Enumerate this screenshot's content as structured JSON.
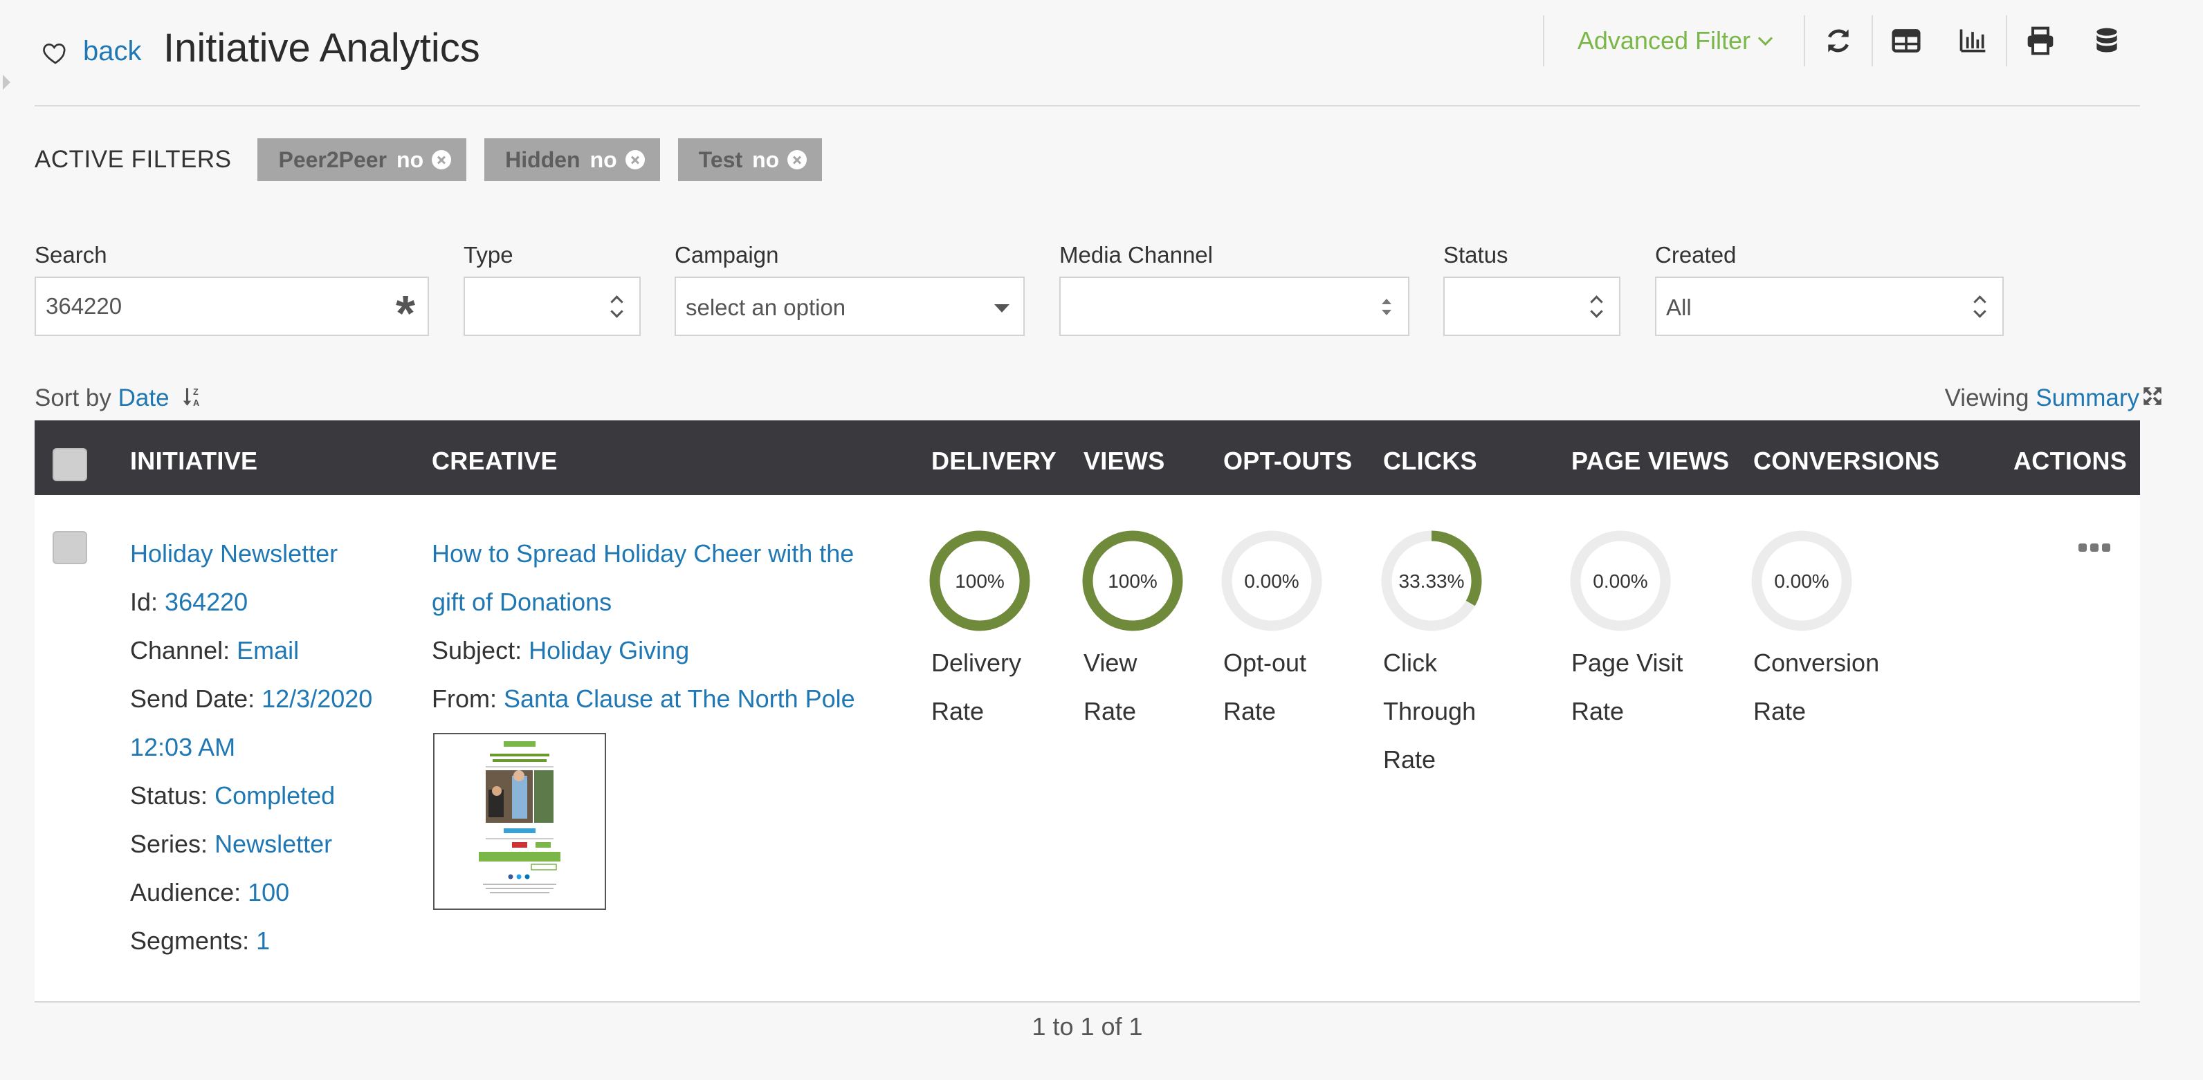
{
  "header": {
    "back_label": "back",
    "title": "Initiative Analytics",
    "advanced_filter_label": "Advanced Filter",
    "toolbar_icons": [
      "refresh-icon",
      "table-icon",
      "bar-chart-icon",
      "print-icon",
      "database-icon"
    ]
  },
  "active_filters": {
    "label": "ACTIVE FILTERS",
    "chips": [
      {
        "key": "Peer2Peer",
        "value": "no"
      },
      {
        "key": "Hidden",
        "value": "no"
      },
      {
        "key": "Test",
        "value": "no"
      }
    ]
  },
  "search": {
    "search_label": "Search",
    "search_value": "364220",
    "type_label": "Type",
    "type_value": "",
    "campaign_label": "Campaign",
    "campaign_placeholder": "select an option",
    "media_label": "Media Channel",
    "media_value": "",
    "status_label": "Status",
    "status_value": "",
    "created_label": "Created",
    "created_value": "All"
  },
  "sort": {
    "prefix": "Sort by",
    "field": "Date",
    "viewing_prefix": "Viewing",
    "viewing_mode": "Summary"
  },
  "table": {
    "columns": [
      "INITIATIVE",
      "CREATIVE",
      "DELIVERY",
      "VIEWS",
      "OPT-OUTS",
      "CLICKS",
      "PAGE VIEWS",
      "CONVERSIONS",
      "ACTIONS"
    ],
    "row": {
      "initiative": {
        "name": "Holiday Newsletter",
        "id_label": "Id:",
        "id_value": "364220",
        "channel_label": "Channel:",
        "channel_value": "Email",
        "send_label": "Send Date:",
        "send_date": "12/3/2020",
        "send_time": "12:03 AM",
        "status_label": "Status:",
        "status_value": "Completed",
        "series_label": "Series:",
        "series_value": "Newsletter",
        "audience_label": "Audience:",
        "audience_value": "100",
        "segments_label": "Segments:",
        "segments_value": "1"
      },
      "creative": {
        "title_line1": "How to Spread Holiday Cheer with the",
        "title_line2": "gift of Donations",
        "subject_label": "Subject:",
        "subject_value": "Holiday Giving",
        "from_label": "From:",
        "from_value": "Santa Clause at The North Pole"
      },
      "metrics": [
        {
          "text": "100%",
          "fraction": 1.0,
          "label_lines": [
            "Delivery",
            "Rate"
          ]
        },
        {
          "text": "100%",
          "fraction": 1.0,
          "label_lines": [
            "View",
            "Rate"
          ]
        },
        {
          "text": "0.00%",
          "fraction": 0.0,
          "label_lines": [
            "Opt-out",
            "Rate"
          ]
        },
        {
          "text": "33.33%",
          "fraction": 0.3333,
          "label_lines": [
            "Click",
            "Through",
            "Rate"
          ]
        },
        {
          "text": "0.00%",
          "fraction": 0.0,
          "label_lines": [
            "Page Visit",
            "Rate"
          ]
        },
        {
          "text": "0.00%",
          "fraction": 0.0,
          "label_lines": [
            "Conversion",
            "Rate"
          ]
        }
      ]
    }
  },
  "pager": {
    "text": "1 to 1 of 1"
  },
  "colors": {
    "ring_fill": "#6f8a3a",
    "ring_track": "#ececec",
    "link": "#1f78b4",
    "accent_green": "#7ab648",
    "header_bg": "#3a3a3e"
  }
}
